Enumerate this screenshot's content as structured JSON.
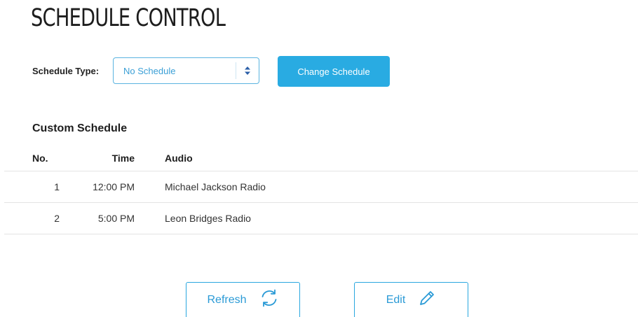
{
  "header": {
    "title": "SCHEDULE CONTROL"
  },
  "schedule_type": {
    "label": "Schedule Type:",
    "selected": "No Schedule",
    "change_button": "Change Schedule"
  },
  "custom_schedule": {
    "title": "Custom Schedule",
    "columns": {
      "no": "No.",
      "time": "Time",
      "audio": "Audio"
    },
    "rows": [
      {
        "no": "1",
        "time": "12:00 PM",
        "audio": "Michael Jackson Radio"
      },
      {
        "no": "2",
        "time": "5:00 PM",
        "audio": "Leon Bridges Radio"
      }
    ]
  },
  "actions": {
    "refresh": "Refresh",
    "edit": "Edit"
  },
  "colors": {
    "accent": "#29abe2",
    "text": "#222222",
    "divider": "#e4e4e4"
  },
  "icons": {
    "refresh": "refresh-icon",
    "edit": "pencil-icon",
    "select": "select-arrows-icon"
  }
}
